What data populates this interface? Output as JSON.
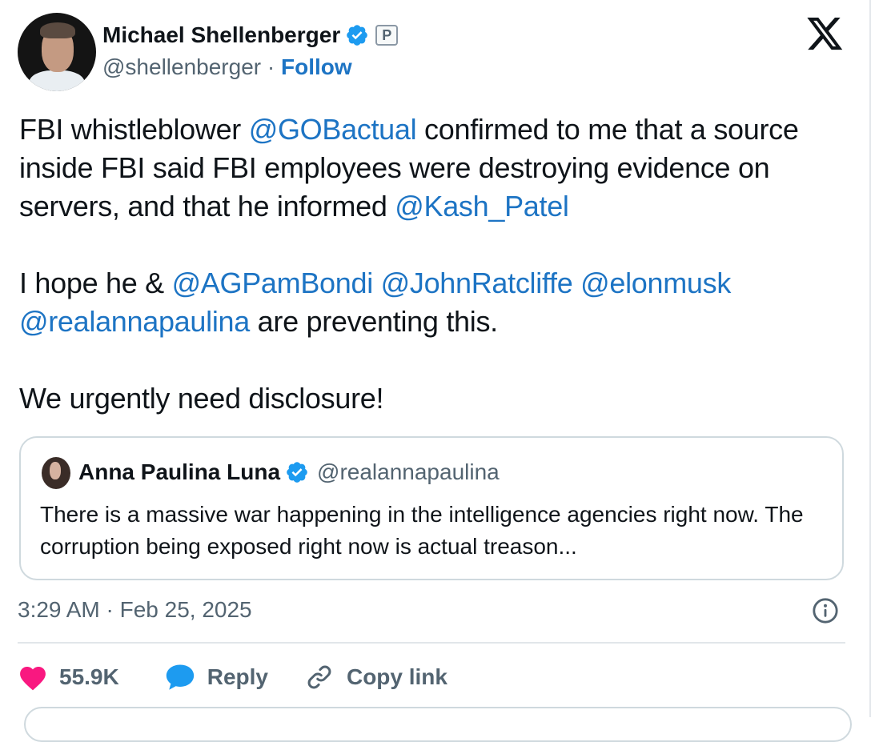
{
  "author": {
    "name": "Michael Shellenberger",
    "handle": "@shellenberger",
    "separator": "·",
    "follow_label": "Follow",
    "badge_letter": "P"
  },
  "tweet": {
    "paragraph1": [
      {
        "text": "FBI whistleblower ",
        "type": "text"
      },
      {
        "text": "@GOBactual",
        "type": "mention"
      },
      {
        "text": " confirmed to me that a source inside FBI said FBI employees were destroying evidence on servers, and that he informed  ",
        "type": "text"
      },
      {
        "text": "@Kash_Patel",
        "type": "mention"
      }
    ],
    "paragraph2": [
      {
        "text": "I hope he & ",
        "type": "text"
      },
      {
        "text": "@AGPamBondi",
        "type": "mention"
      },
      {
        "text": " ",
        "type": "text"
      },
      {
        "text": "@JohnRatcliffe",
        "type": "mention"
      },
      {
        "text": " ",
        "type": "text"
      },
      {
        "text": "@elonmusk",
        "type": "mention"
      },
      {
        "text": " ",
        "type": "text"
      },
      {
        "text": "@realannapaulina",
        "type": "mention"
      },
      {
        "text": " are preventing this.",
        "type": "text"
      }
    ],
    "paragraph3": "We urgently need disclosure!"
  },
  "quote": {
    "name": "Anna Paulina Luna",
    "handle": "@realannapaulina",
    "text": "There is a massive war happening in the intelligence agencies right now. The corruption being exposed right now is actual treason..."
  },
  "timestamp": "3:29 AM · Feb 25, 2025",
  "actions": {
    "likes": "55.9K",
    "reply_label": "Reply",
    "copy_link_label": "Copy link"
  },
  "colors": {
    "mention": "#1d74c4",
    "like": "#f91880",
    "reply": "#1d9bf0",
    "verified": "#1d9bf0",
    "secondary": "#536471"
  },
  "icons": {
    "verified": "verified-badge-icon",
    "x_logo": "x-logo-icon",
    "info": "info-icon",
    "like": "heart-icon",
    "reply": "speech-bubble-icon",
    "copy_link": "link-icon"
  }
}
